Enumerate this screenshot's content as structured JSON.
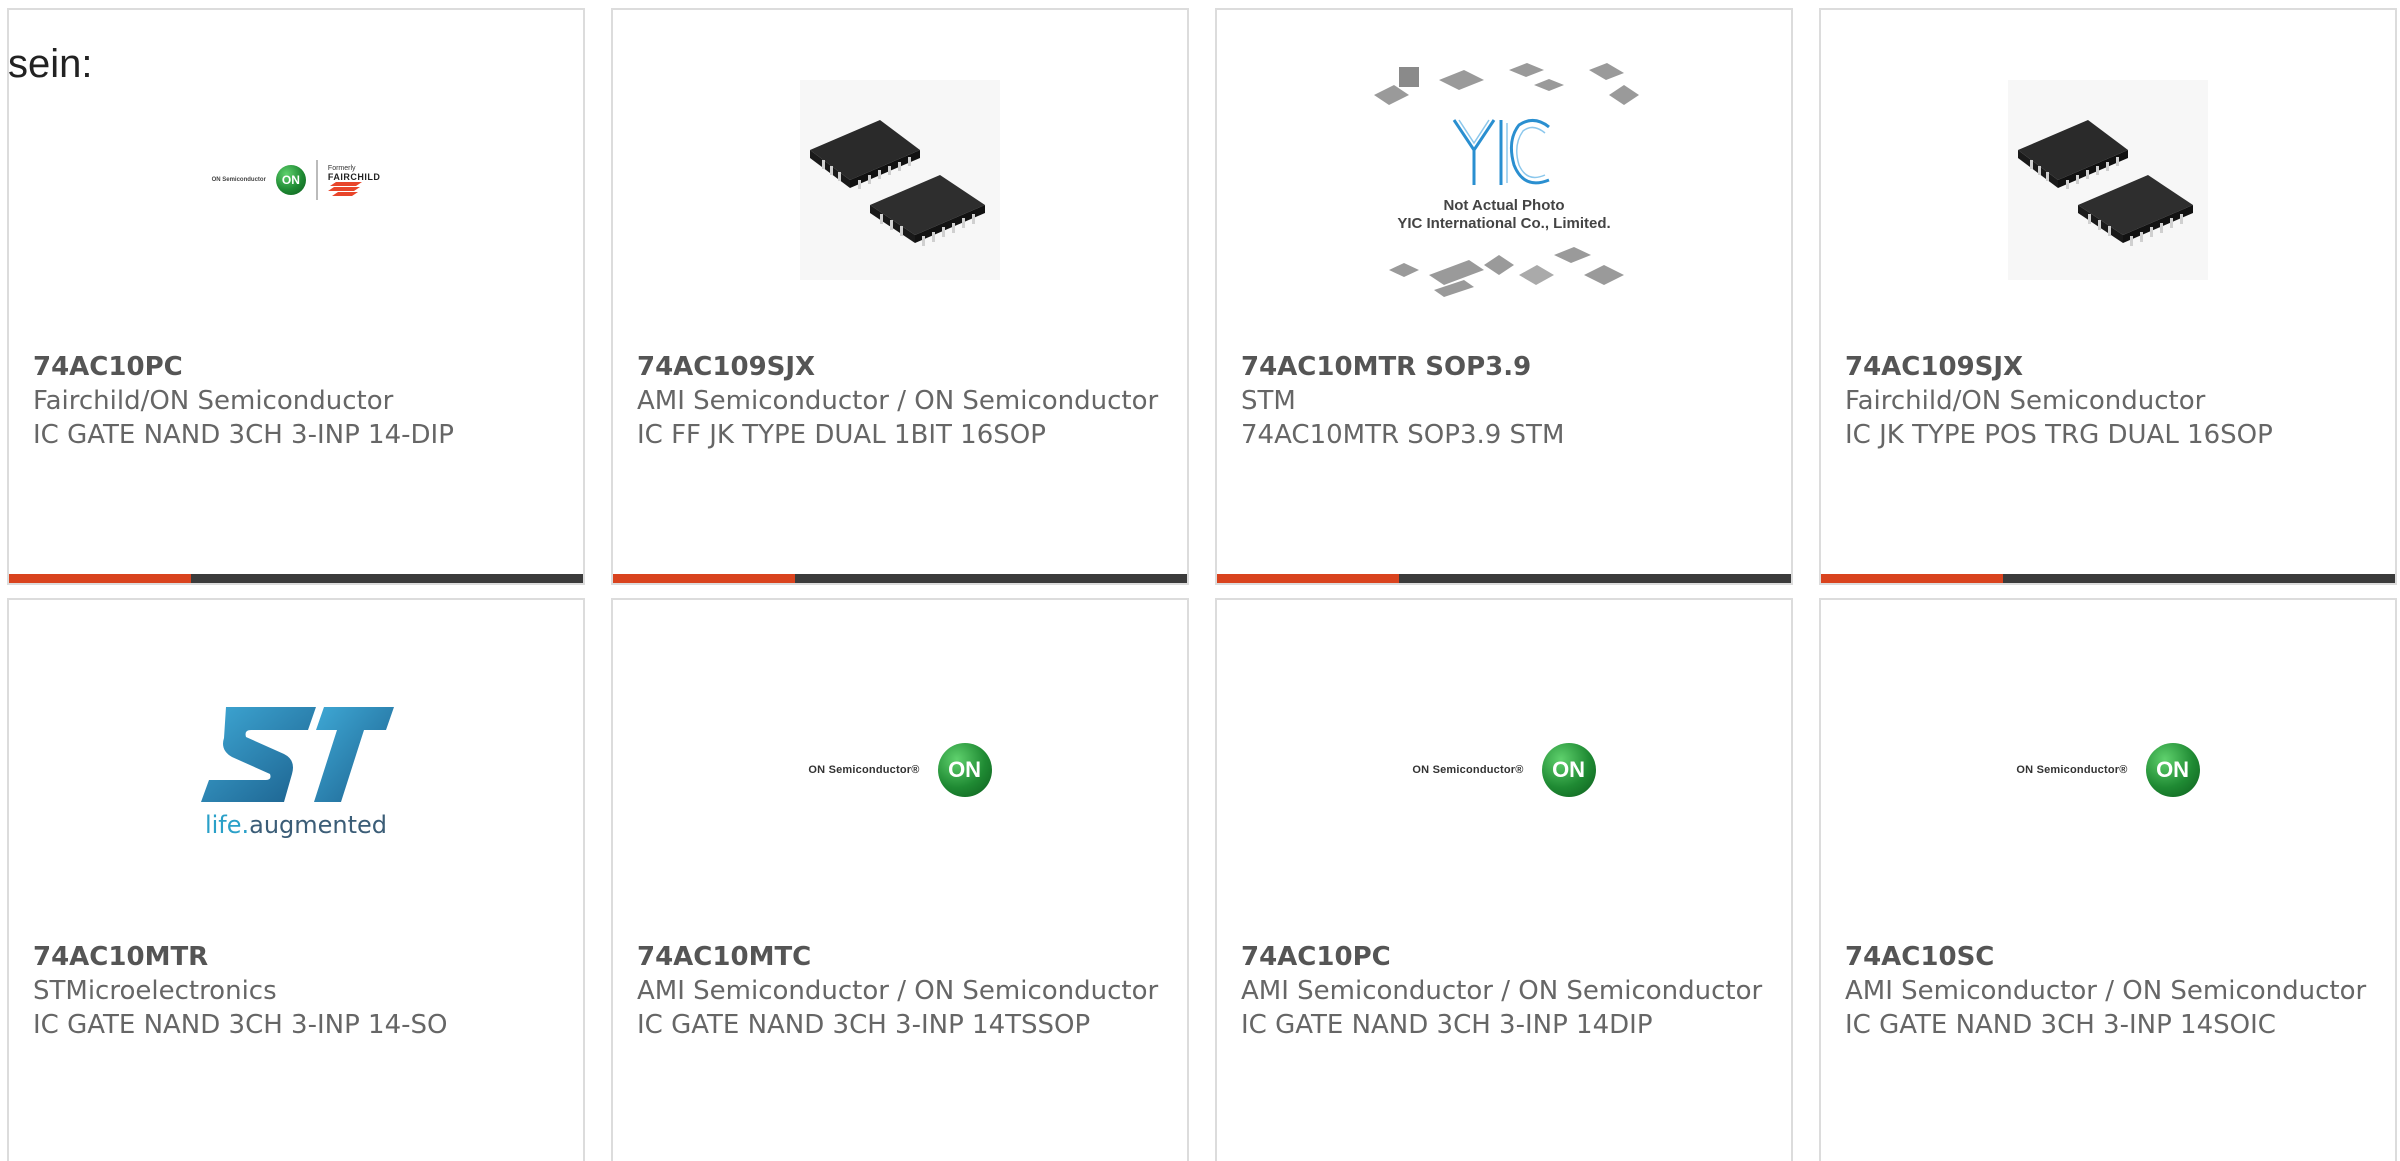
{
  "lead_text": "sein:",
  "colors": {
    "accent": "#d9431e",
    "bar": "#3b3b3b",
    "border": "#dcdcdc",
    "text": "#666666"
  },
  "products": [
    {
      "part_number": "74AC10PC",
      "manufacturer": "Fairchild/ON Semiconductor",
      "description": "IC GATE NAND 3CH 3-INP 14-DIP",
      "image": "fairchild-on-logo",
      "logo_text": {
        "brand": "ON Semiconductor",
        "formerly": "Formerly",
        "fairchild": "FAIRCHILD",
        "on": "ON"
      }
    },
    {
      "part_number": "74AC109SJX",
      "manufacturer": "AMI Semiconductor / ON Semiconductor",
      "description": "IC FF JK TYPE DUAL 1BIT 16SOP",
      "image": "sop-chip-photo"
    },
    {
      "part_number": "74AC10MTR SOP3.9",
      "manufacturer": "STM",
      "description": "74AC10MTR SOP3.9 STM",
      "image": "yic-placeholder",
      "logo_text": {
        "brand": "YIC",
        "line1": "Not Actual Photo",
        "line2": "YIC International Co., Limited."
      }
    },
    {
      "part_number": "74AC109SJX",
      "manufacturer": "Fairchild/ON Semiconductor",
      "description": "IC JK TYPE POS TRG DUAL 16SOP",
      "image": "sop-chip-photo"
    },
    {
      "part_number": "74AC10MTR",
      "manufacturer": "STMicroelectronics",
      "description": "IC GATE NAND 3CH 3-INP 14-SO",
      "image": "st-logo",
      "logo_text": {
        "tag_life": "life.",
        "tag_rest": "augmented"
      }
    },
    {
      "part_number": "74AC10MTC",
      "manufacturer": "AMI Semiconductor / ON Semiconductor",
      "description": "IC GATE NAND 3CH 3-INP 14TSSOP",
      "image": "on-semi-logo",
      "logo_text": {
        "brand": "ON Semiconductor®",
        "on": "ON"
      }
    },
    {
      "part_number": "74AC10PC",
      "manufacturer": "AMI Semiconductor / ON Semiconductor",
      "description": "IC GATE NAND 3CH 3-INP 14DIP",
      "image": "on-semi-logo",
      "logo_text": {
        "brand": "ON Semiconductor®",
        "on": "ON"
      }
    },
    {
      "part_number": "74AC10SC",
      "manufacturer": "AMI Semiconductor / ON Semiconductor",
      "description": "IC GATE NAND 3CH 3-INP 14SOIC",
      "image": "on-semi-logo",
      "logo_text": {
        "brand": "ON Semiconductor®",
        "on": "ON"
      }
    }
  ]
}
